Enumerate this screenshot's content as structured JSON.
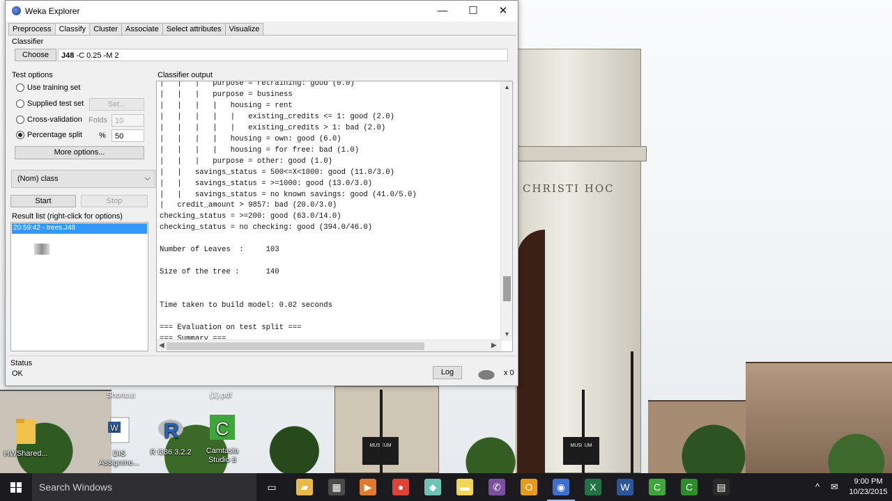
{
  "window": {
    "title": "Weka Explorer",
    "controls": {
      "minimize": "—",
      "maximize": "☐",
      "close": "✕"
    }
  },
  "tabs": [
    "Preprocess",
    "Classify",
    "Cluster",
    "Associate",
    "Select attributes",
    "Visualize"
  ],
  "active_tab": "Classify",
  "classifier": {
    "section_label": "Classifier",
    "choose_label": "Choose",
    "name": "J48",
    "options": " -C 0.25 -M 2"
  },
  "test_options": {
    "title": "Test options",
    "use_training_set": "Use training set",
    "supplied_test_set": "Supplied test set",
    "set_button": "Set...",
    "cross_validation": "Cross-validation",
    "folds_label": "Folds",
    "folds_value": "10",
    "percentage_split": "Percentage split",
    "percent_symbol": "%",
    "percent_value": "50",
    "selected": "percentage_split",
    "more_options": "More options..."
  },
  "class_select": {
    "value": "(Nom) class"
  },
  "actions": {
    "start": "Start",
    "stop": "Stop"
  },
  "result_list": {
    "title": "Result list (right-click for options)",
    "items": [
      "20:59:42 - trees.J48"
    ]
  },
  "output": {
    "title": "Classifier output",
    "text": "|   |   |   purpose = retraining: good (0.0)\n|   |   |   purpose = business\n|   |   |   |   housing = rent\n|   |   |   |   |   existing_credits <= 1: good (2.0)\n|   |   |   |   |   existing_credits > 1: bad (2.0)\n|   |   |   |   housing = own: good (6.0)\n|   |   |   |   housing = for free: bad (1.0)\n|   |   |   purpose = other: good (1.0)\n|   |   savings_status = 500<=X<1000: good (11.0/3.0)\n|   |   savings_status = >=1000: good (13.0/3.0)\n|   |   savings_status = no known savings: good (41.0/5.0)\n|   credit_amount > 9857: bad (20.0/3.0)\nchecking_status = >=200: good (63.0/14.0)\nchecking_status = no checking: good (394.0/46.0)\n\nNumber of Leaves  : \t103\n\nSize of the tree : \t140\n\n\nTime taken to build model: 0.02 seconds\n\n=== Evaluation on test split ===\n=== Summary ==="
  },
  "status": {
    "title": "Status",
    "text": "OK",
    "log_button": "Log",
    "count": "x 0"
  },
  "desktop_icons": [
    {
      "label": "HWShared...",
      "icon": "folder-icon",
      "color": "#f0c24a"
    },
    {
      "label": "DIS Assignme...",
      "icon": "word-doc-icon",
      "color": "#2b579a"
    },
    {
      "label": "R i386 3.2.2",
      "icon": "r-icon",
      "color": "#2165b6"
    },
    {
      "label": "Camtasia Studio 8",
      "icon": "camtasia-icon",
      "color": "#3ea63a"
    }
  ],
  "desktop_ghost_labels": [
    "Shortcut",
    "(1).pdf"
  ],
  "wallpaper": {
    "arch_inscription": "CHRISTI HOC",
    "museum_sign": "MUSEUM"
  },
  "taskbar": {
    "search_placeholder": "Search Windows",
    "icons": [
      {
        "name": "task-view-icon",
        "glyph": "▭",
        "color": "transparent"
      },
      {
        "name": "file-explorer-icon",
        "glyph": "▰",
        "color": "#e8b84a"
      },
      {
        "name": "calculator-icon",
        "glyph": "▦",
        "color": "#4a4a4a"
      },
      {
        "name": "media-player-icon",
        "glyph": "▶",
        "color": "#e07a2c"
      },
      {
        "name": "chrome-icon",
        "glyph": "●",
        "color": "#db4437"
      },
      {
        "name": "paper-icon",
        "glyph": "◆",
        "color": "#6ec3b5"
      },
      {
        "name": "sticky-notes-icon",
        "glyph": "▬",
        "color": "#f3d55a"
      },
      {
        "name": "viber-icon",
        "glyph": "✆",
        "color": "#7b519d"
      },
      {
        "name": "outlook-icon",
        "glyph": "O",
        "color": "#e59a1b"
      },
      {
        "name": "weka-icon",
        "glyph": "◉",
        "color": "#3d6fd1"
      },
      {
        "name": "excel-icon",
        "glyph": "X",
        "color": "#217346"
      },
      {
        "name": "word-icon",
        "glyph": "W",
        "color": "#2b579a"
      },
      {
        "name": "camtasia-icon",
        "glyph": "C",
        "color": "#3ea63a"
      },
      {
        "name": "camtasia-recorder-icon",
        "glyph": "C",
        "color": "#2f8c2b"
      },
      {
        "name": "clapper-icon",
        "glyph": "▤",
        "color": "#2b2b2b"
      }
    ],
    "tray": {
      "chevron": "^",
      "message": "✉",
      "volume": "🔊"
    },
    "time": "9:00 PM",
    "date": "10/23/2015"
  }
}
